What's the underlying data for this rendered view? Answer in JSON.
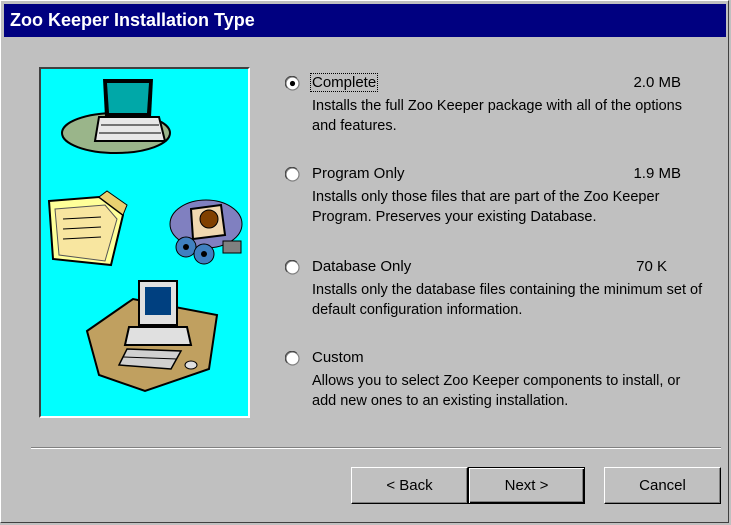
{
  "window": {
    "title": "Zoo Keeper Installation Type"
  },
  "options": [
    {
      "id": "complete",
      "label": "Complete",
      "size": "2.0 MB",
      "description": "Installs the full Zoo Keeper package with all of the options and features.",
      "selected": true
    },
    {
      "id": "program-only",
      "label": "Program Only",
      "size": "1.9 MB",
      "description": "Installs only those files that are part of the Zoo Keeper Program. Preserves your existing Database.",
      "selected": false
    },
    {
      "id": "database-only",
      "label": "Database Only",
      "size": "70 K",
      "description": "Installs only the database files containing the minimum set of default configuration information.",
      "selected": false
    },
    {
      "id": "custom",
      "label": "Custom",
      "size": "",
      "description": "Allows you to select Zoo Keeper components to install, or add new ones to an existing installation.",
      "selected": false
    }
  ],
  "buttons": {
    "back": "< Back",
    "next": "Next >",
    "cancel": "Cancel"
  },
  "illustration": {
    "background": "#00ffff",
    "icons": [
      "laptop-icon",
      "folder-icon",
      "disk-drive-icon",
      "desktop-computer-icon"
    ]
  },
  "colors": {
    "titlebar": "#000080",
    "dialog": "#c0c0c0"
  }
}
